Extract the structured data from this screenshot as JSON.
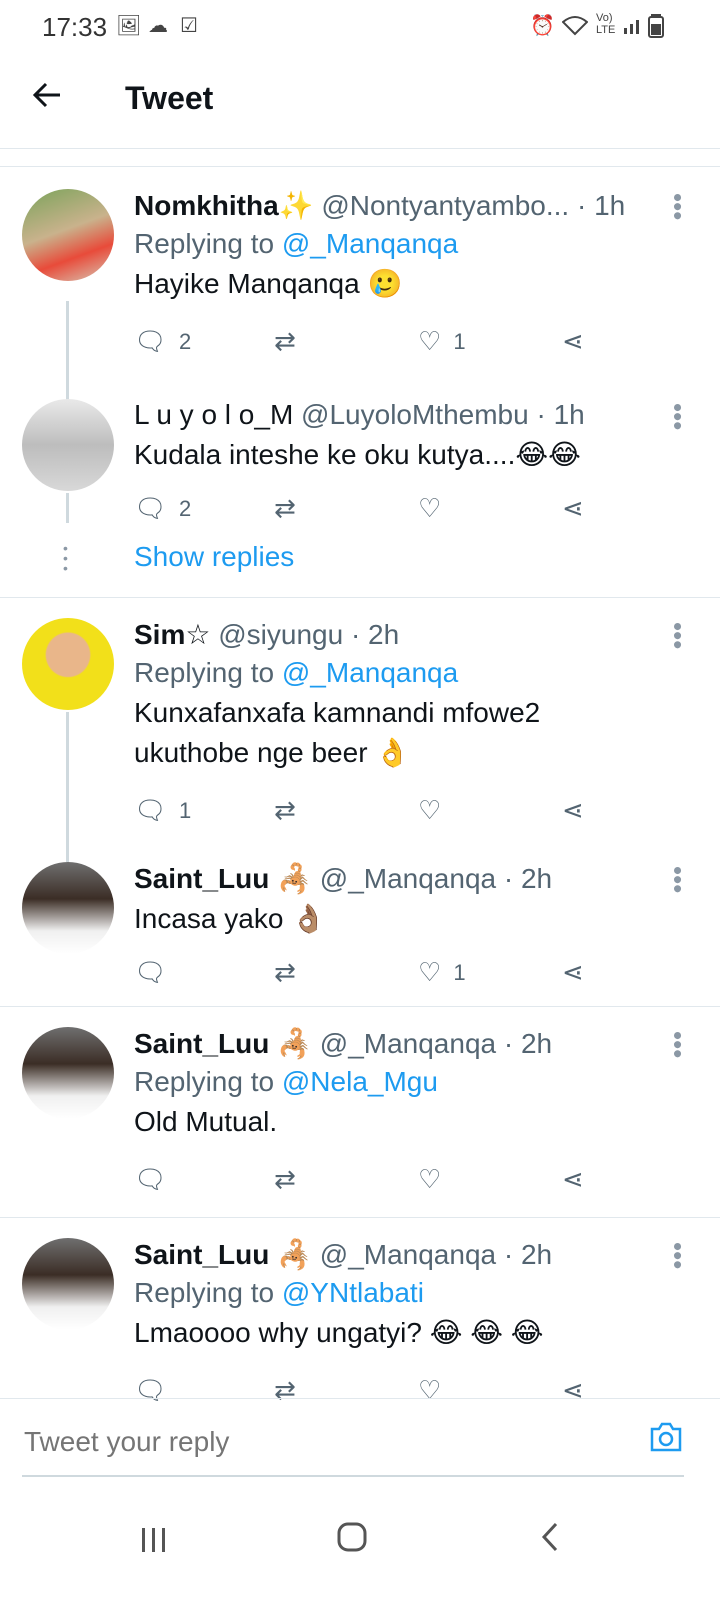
{
  "status_bar": {
    "time": "17:33",
    "left_icons": [
      "gallery-icon",
      "cloud-icon",
      "checkbox-icon"
    ],
    "right_icons": [
      "alarm-icon",
      "wifi-icon",
      "volte-icon",
      "signal-icon",
      "battery-icon"
    ],
    "volte_label": "Vo) LTE"
  },
  "header": {
    "title": "Tweet"
  },
  "tweets": [
    {
      "name": "Nomkhitha✨",
      "handle": "@Nontyantyambo...",
      "time": "· 1h",
      "replying_prefix": "Replying to",
      "replying_to": "@_Manqanqa",
      "text": "Hayike Manqanqa 🥲",
      "reply_count": "2",
      "retweet_count": "",
      "like_count": "1"
    },
    {
      "name": "L u y o l o_M",
      "handle": "@LuyoloMthembu",
      "time": "· 1h",
      "text": "Kudala inteshe ke oku kutya....😂😂",
      "reply_count": "2",
      "retweet_count": "",
      "like_count": ""
    },
    {
      "name": "Sim☆",
      "handle": "@siyungu",
      "time": "· 2h",
      "replying_prefix": "Replying to",
      "replying_to": "@_Manqanqa",
      "text": "Kunxafanxafa kamnandi mfowe2 ukuthobe nge beer 👌",
      "reply_count": "1",
      "retweet_count": "",
      "like_count": ""
    },
    {
      "name": "Saint_Luu 🦂",
      "handle": "@_Manqanqa",
      "time": "· 2h",
      "text": "Incasa yako 👌🏽",
      "reply_count": "",
      "retweet_count": "",
      "like_count": "1"
    },
    {
      "name": "Saint_Luu 🦂",
      "handle": "@_Manqanqa",
      "time": "· 2h",
      "replying_prefix": "Replying to",
      "replying_to": "@Nela_Mgu",
      "text": "Old Mutual.",
      "reply_count": "",
      "retweet_count": "",
      "like_count": ""
    },
    {
      "name": "Saint_Luu 🦂",
      "handle": "@_Manqanqa",
      "time": "· 2h",
      "replying_prefix": "Replying to",
      "replying_to": "@YNtlabati",
      "text": "Lmaoooo why ungatyi? 😂 😂 😂",
      "reply_count": "",
      "retweet_count": "",
      "like_count": ""
    }
  ],
  "show_replies_label": "Show replies",
  "composer": {
    "placeholder": "Tweet your reply"
  },
  "colors": {
    "accent": "#1d9bf0",
    "text": "#0f1419",
    "muted": "#536471"
  }
}
